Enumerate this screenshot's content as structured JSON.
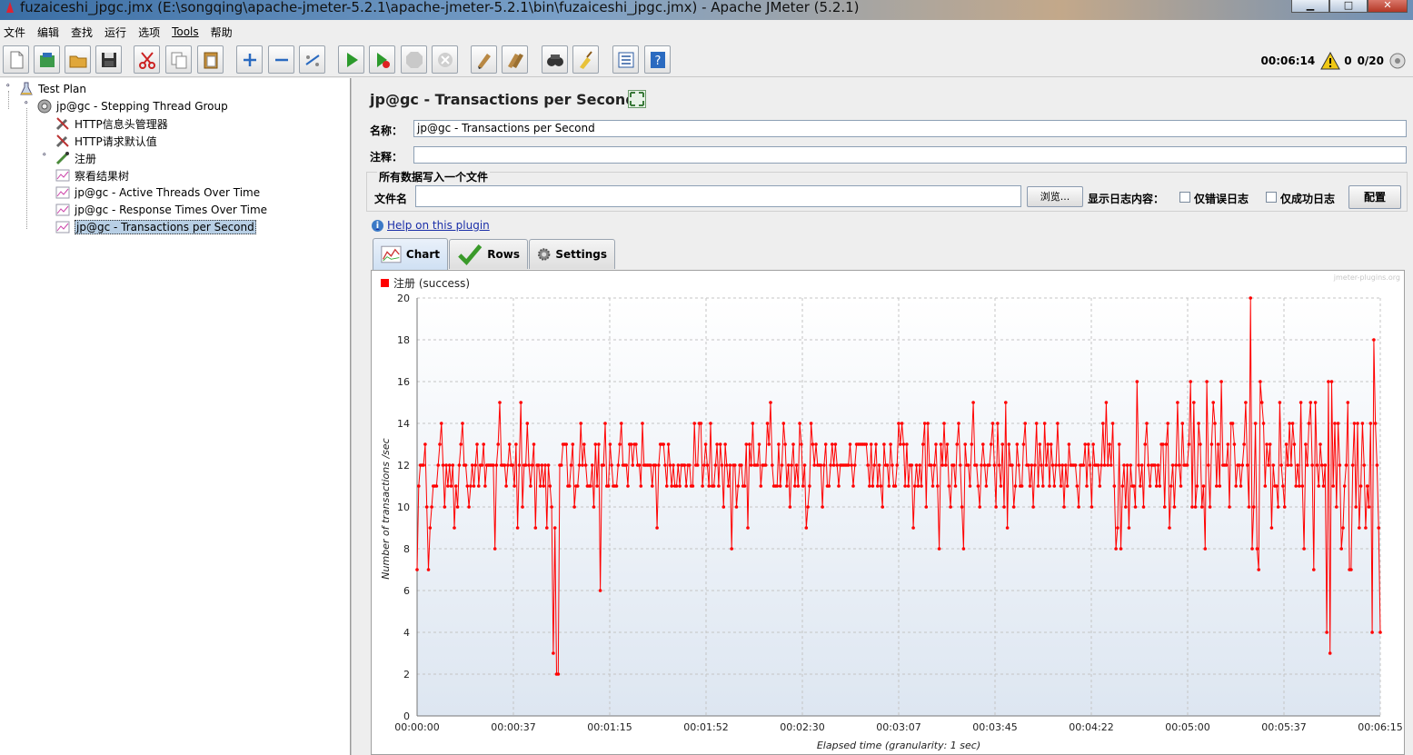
{
  "window": {
    "title": "fuzaiceshi_jpgc.jmx (E:\\songqing\\apache-jmeter-5.2.1\\apache-jmeter-5.2.1\\bin\\fuzaiceshi_jpgc.jmx) - Apache JMeter (5.2.1)",
    "minimize": "▁",
    "maximize": "□",
    "close": "✕"
  },
  "menu": [
    {
      "label": "文件"
    },
    {
      "label": "编辑"
    },
    {
      "label": "查找"
    },
    {
      "label": "运行"
    },
    {
      "label": "选项"
    },
    {
      "label": "Tools"
    },
    {
      "label": "帮助"
    }
  ],
  "toolbar": {
    "icons": [
      "new-icon",
      "templates-icon",
      "open-icon",
      "save-icon",
      "cut-icon",
      "copy-icon",
      "paste-icon",
      "expand-icon",
      "collapse-icon",
      "toggle-icon",
      "start-icon",
      "start-no-pause-icon",
      "stop-icon",
      "shutdown-icon",
      "clear-icon",
      "clear-all-icon",
      "search-icon",
      "reset-search-icon",
      "function-helper-icon",
      "help-icon"
    ],
    "elapsed": "00:06:14",
    "warnings": "0",
    "threads": "0/20"
  },
  "tree": [
    {
      "label": "Test Plan",
      "icon": "test-plan-icon"
    },
    {
      "label": "jp@gc - Stepping Thread Group",
      "icon": "thread-group-icon"
    },
    {
      "label": "HTTP信息头管理器",
      "icon": "config-wrench-icon"
    },
    {
      "label": "HTTP请求默认值",
      "icon": "config-wrench-icon"
    },
    {
      "label": "注册",
      "icon": "sampler-pipette-icon"
    },
    {
      "label": "察看结果树",
      "icon": "listener-chart-icon"
    },
    {
      "label": "jp@gc - Active Threads Over Time",
      "icon": "listener-chart-icon"
    },
    {
      "label": "jp@gc - Response Times Over Time",
      "icon": "listener-chart-icon"
    },
    {
      "label": "jp@gc - Transactions per Second",
      "icon": "listener-chart-icon"
    }
  ],
  "panel": {
    "title": "jp@gc - Transactions per Second",
    "name_label": "名称：",
    "name_value": "jp@gc - Transactions per Second",
    "comment_label": "注释：",
    "comment_value": "",
    "file_group_legend": "所有数据写入一个文件",
    "filename_label": "文件名",
    "filename_value": "",
    "browse_label": "浏览...",
    "log_label": "显示日志内容：",
    "errors_only_label": "仅错误日志",
    "success_only_label": "仅成功日志",
    "configure_label": "配置",
    "help_link": "Help on this plugin",
    "tabs": [
      {
        "label": "Chart",
        "icon": "chart-icon"
      },
      {
        "label": "Rows",
        "icon": "check-icon"
      },
      {
        "label": "Settings",
        "icon": "gear-icon"
      }
    ]
  },
  "chart_data": {
    "type": "line",
    "watermark": "jmeter-plugins.org",
    "xlabel": "Elapsed time (granularity: 1 sec)",
    "ylabel": "Number of transactions /sec",
    "ylim": [
      0,
      20
    ],
    "yticks": [
      "0",
      "2",
      "4",
      "6",
      "8",
      "10",
      "12",
      "14",
      "16",
      "18",
      "20"
    ],
    "xlim_seconds": [
      0,
      375
    ],
    "xticks": [
      "00:00:00",
      "00:00:37",
      "00:01:15",
      "00:01:52",
      "00:02:30",
      "00:03:07",
      "00:03:45",
      "00:04:22",
      "00:05:00",
      "00:05:37",
      "00:06:15"
    ],
    "grid": true,
    "color": "#ff0000",
    "series": [
      {
        "name": "注册 (success)",
        "values": [
          7,
          11,
          12,
          12,
          12,
          13,
          10,
          7,
          9,
          10,
          11,
          11,
          11,
          12,
          13,
          14,
          12,
          10,
          12,
          11,
          12,
          11,
          12,
          9,
          11,
          10,
          12,
          13,
          14,
          12,
          12,
          11,
          10,
          11,
          12,
          11,
          12,
          13,
          11,
          12,
          12,
          13,
          11,
          12,
          12,
          12,
          12,
          12,
          8,
          12,
          13,
          15,
          12,
          12,
          12,
          11,
          12,
          13,
          12,
          12,
          11,
          13,
          9,
          12,
          15,
          10,
          12,
          12,
          14,
          12,
          11,
          12,
          13,
          9,
          12,
          12,
          11,
          12,
          11,
          12,
          9,
          12,
          11,
          10,
          3,
          9,
          2,
          2,
          12,
          12,
          13,
          13,
          13,
          11,
          11,
          12,
          13,
          10,
          11,
          11,
          12,
          14,
          12,
          13,
          12,
          11,
          11,
          11,
          12,
          10,
          13,
          11,
          13,
          6,
          12,
          12,
          14,
          11,
          11,
          13,
          12,
          11,
          11,
          11,
          12,
          13,
          14,
          12,
          12,
          12,
          11,
          13,
          13,
          12,
          13,
          13,
          12,
          12,
          11,
          14,
          12,
          12,
          12,
          12,
          12,
          11,
          12,
          12,
          9,
          12,
          13,
          13,
          13,
          12,
          11,
          13,
          12,
          11,
          12,
          11,
          11,
          12,
          11,
          12,
          12,
          12,
          11,
          12,
          12,
          11,
          11,
          14,
          12,
          12,
          14,
          14,
          11,
          12,
          13,
          12,
          11,
          14,
          11,
          11,
          12,
          13,
          11,
          13,
          12,
          10,
          13,
          12,
          11,
          12,
          8,
          12,
          12,
          10,
          11,
          12,
          12,
          11,
          11,
          13,
          9,
          13,
          12,
          14,
          12,
          12,
          12,
          13,
          11,
          12,
          12,
          12,
          14,
          13,
          15,
          12,
          11,
          11,
          11,
          13,
          11,
          12,
          14,
          13,
          11,
          12,
          10,
          12,
          13,
          11,
          12,
          11,
          14,
          13,
          11,
          12,
          9,
          10,
          11,
          14,
          13,
          12,
          13,
          12,
          12,
          12,
          10,
          12,
          13,
          11,
          11,
          12,
          13,
          12,
          13,
          12,
          11,
          12,
          12,
          12,
          12,
          12,
          12,
          13,
          12,
          11,
          12,
          13,
          13,
          13,
          13,
          13,
          13,
          13,
          12,
          11,
          13,
          11,
          12,
          13,
          11,
          12,
          11,
          10,
          13,
          12,
          12,
          11,
          13,
          12,
          11,
          11,
          12,
          14,
          13,
          14,
          13,
          11,
          13,
          11,
          12,
          12,
          9,
          11,
          12,
          11,
          12,
          11,
          13,
          14,
          10,
          14,
          12,
          12,
          11,
          12,
          13,
          11,
          8,
          13,
          12,
          14,
          12,
          13,
          11,
          10,
          12,
          12,
          11,
          13,
          14,
          12,
          10,
          8,
          13,
          12,
          12,
          11,
          13,
          15,
          12,
          12,
          11,
          10,
          12,
          13,
          12,
          11,
          12,
          12,
          13,
          14,
          12,
          10,
          14,
          12,
          11,
          13,
          10,
          15,
          9,
          13,
          12,
          12,
          10,
          11,
          13,
          12,
          11,
          11,
          13,
          14,
          12,
          12,
          11,
          12,
          10,
          12,
          14,
          11,
          13,
          12,
          11,
          14,
          12,
          13,
          11,
          13,
          12,
          11,
          12,
          14,
          12,
          11,
          12,
          10,
          12,
          11,
          13,
          12,
          12,
          12,
          12,
          11,
          10,
          12,
          12,
          12,
          13,
          11,
          13,
          12,
          10,
          13,
          12,
          12,
          12,
          11,
          12,
          14,
          12,
          15,
          12,
          13,
          12,
          14,
          11,
          8,
          9,
          13,
          8,
          11,
          12,
          10,
          12,
          9,
          12,
          11,
          11,
          10,
          16,
          12,
          11,
          12,
          10,
          13,
          14,
          12,
          11,
          12,
          12,
          12,
          11,
          12,
          11,
          13,
          13,
          10,
          13,
          14,
          9,
          11,
          12,
          10,
          12,
          15,
          12,
          11,
          14,
          12,
          12,
          12,
          13,
          16,
          10,
          15,
          10,
          11,
          14,
          13,
          10,
          11,
          8,
          16,
          12,
          10,
          13,
          15,
          14,
          11,
          13,
          11,
          16,
          12,
          12,
          12,
          13,
          10,
          14,
          14,
          13,
          11,
          12,
          12,
          11,
          12,
          13,
          15,
          12,
          10,
          20,
          8,
          10,
          14,
          8,
          7,
          16,
          15,
          14,
          11,
          13,
          12,
          13,
          9,
          12,
          11,
          11,
          10,
          15,
          12,
          11,
          10,
          13,
          12,
          14,
          12,
          14,
          13,
          11,
          12,
          11,
          15,
          11,
          8,
          13,
          12,
          14,
          15,
          12,
          7,
          15,
          12,
          11,
          13,
          12,
          11,
          12,
          4,
          16,
          3,
          16,
          11,
          14,
          10,
          14,
          12,
          8,
          9,
          11,
          12,
          15,
          7,
          7,
          12,
          14,
          10,
          14,
          9,
          11,
          14,
          12,
          9,
          11,
          10,
          14,
          4,
          18,
          14,
          12,
          9,
          4
        ]
      }
    ]
  }
}
